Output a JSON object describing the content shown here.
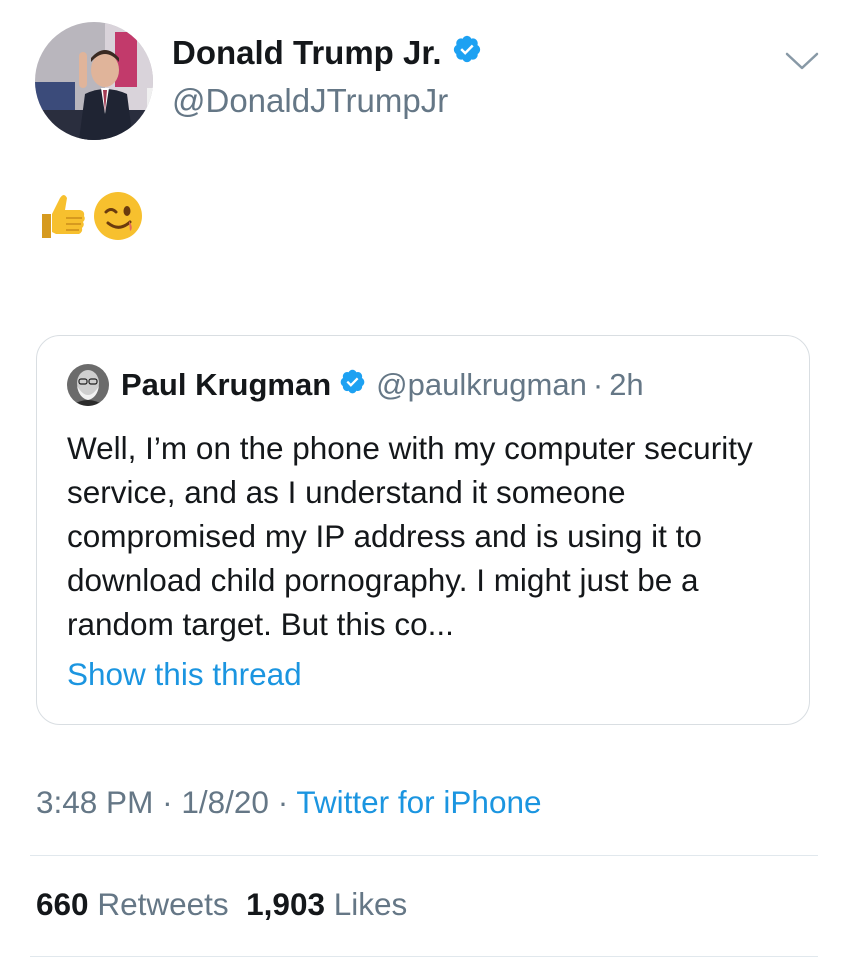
{
  "tweet": {
    "author": {
      "name": "Donald Trump Jr.",
      "handle": "@DonaldJTrumpJr",
      "verified": true
    },
    "text_emojis": [
      "thumbs-up",
      "winking-face"
    ],
    "quoted_tweet": {
      "name": "Paul Krugman",
      "handle": "@paulkrugman",
      "separator": "·",
      "time": "2h",
      "verified": true,
      "body": "Well, I’m on the phone with my computer security service, and as I understand it someone compromised my IP address and is using it to download child pornography. I might just be a random target. But this co...",
      "show_thread_label": "Show this thread"
    },
    "meta": {
      "time": "3:48 PM",
      "sep1": "·",
      "date": "1/8/20",
      "sep2": "·",
      "source": "Twitter for iPhone"
    },
    "stats": {
      "retweets_count": "660",
      "retweets_label": "Retweets",
      "likes_count": "1,903",
      "likes_label": "Likes"
    }
  },
  "colors": {
    "link_blue": "#1b95e0",
    "secondary_gray": "#657786",
    "verified_blue": "#1da1f2",
    "border": "#d9dee2"
  }
}
